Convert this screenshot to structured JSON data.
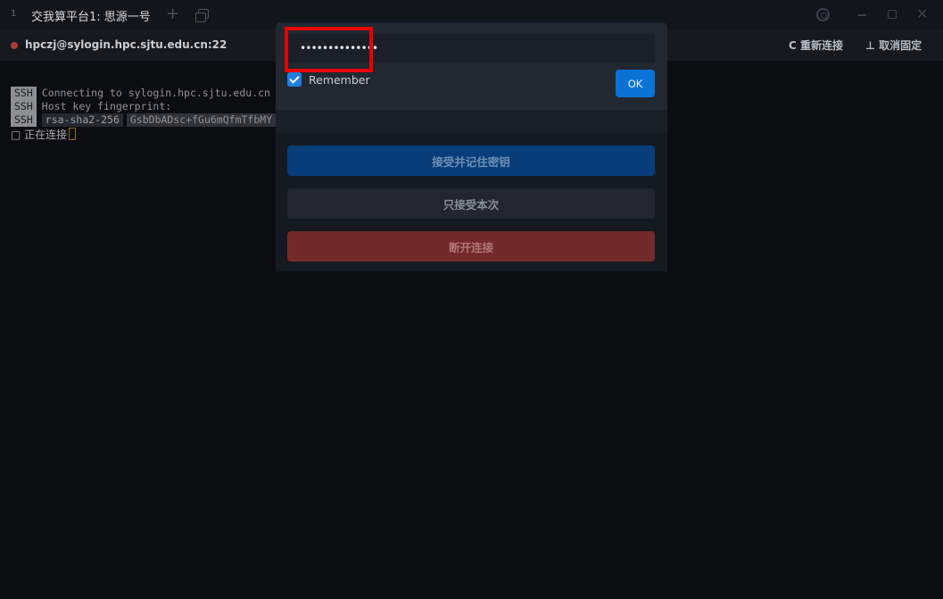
{
  "titlebar": {
    "tab_index": "1",
    "tab_title": "交我算平台1: 思源一号",
    "add_tab": "+",
    "close_glyph": "✕"
  },
  "session": {
    "host": "hpczj@sylogin.hpc.sjtu.edu.cn:22",
    "reconnect_label": "C 重新连接",
    "unpin_label": "⊥ 取消固定",
    "status_color": "#b3393b"
  },
  "terminal": {
    "tag": "SSH",
    "lines": [
      "Connecting to sylogin.hpc.sjtu.edu.cn",
      "Host key fingerprint:"
    ],
    "algorithm": "rsa-sha2-256",
    "fingerprint": "GsbDbADsc+fGu6mQfmTfbMY",
    "connecting": "□ 正在连接"
  },
  "prompt": {
    "password_value": "••••••••••••••",
    "remember_label": "Remember",
    "remember_checked": true,
    "ok_label": "OK"
  },
  "hostkey": {
    "accept_label": "接受并记住密钥",
    "once_label": "只接受本次",
    "disconnect_label": "断开连接"
  },
  "icons": [
    "gear-icon",
    "minimize-icon",
    "maximize-icon",
    "close-icon",
    "new-window-icon",
    "checkbox-check-icon"
  ],
  "colors": {
    "accent": "#0b73d6",
    "highlight": "#ea0000",
    "danger": "#722a2b"
  }
}
